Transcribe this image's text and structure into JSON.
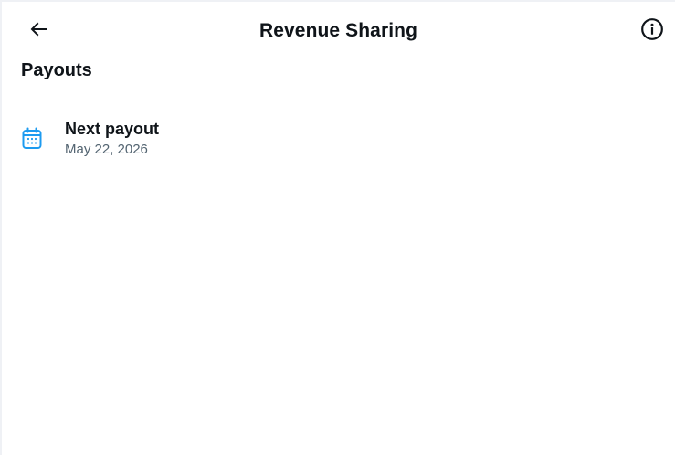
{
  "header": {
    "title": "Revenue Sharing",
    "back_icon": "arrow-left-icon",
    "info_icon": "info-circle-icon"
  },
  "section": {
    "title": "Payouts"
  },
  "payout": {
    "icon": "calendar-icon",
    "icon_color": "#1d9bf0",
    "label": "Next payout",
    "date": "May 22, 2026"
  }
}
